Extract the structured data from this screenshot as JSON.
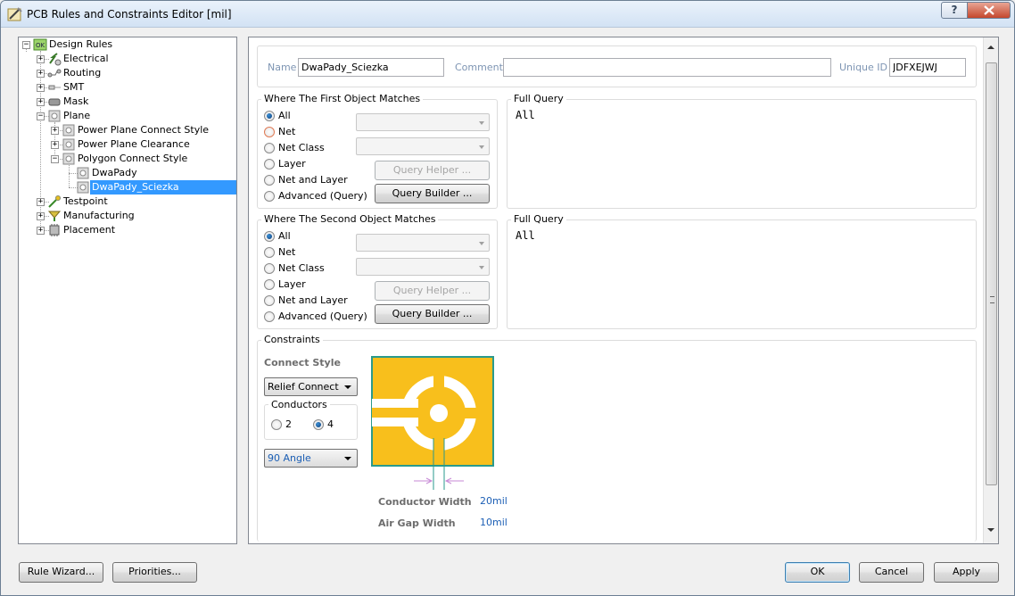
{
  "window": {
    "title": "PCB Rules and Constraints Editor [mil]",
    "help_glyph": "?",
    "close_glyph": "X"
  },
  "tree": {
    "items": [
      {
        "label": "Design Rules",
        "icon": "design-rules-icon"
      },
      {
        "label": "Electrical",
        "icon": "electrical-icon"
      },
      {
        "label": "Routing",
        "icon": "routing-icon"
      },
      {
        "label": "SMT",
        "icon": "smt-icon"
      },
      {
        "label": "Mask",
        "icon": "mask-icon"
      },
      {
        "label": "Plane",
        "icon": "plane-icon"
      },
      {
        "label": "Power Plane Connect Style",
        "icon": "rule-icon"
      },
      {
        "label": "Power Plane Clearance",
        "icon": "rule-icon"
      },
      {
        "label": "Polygon Connect Style",
        "icon": "rule-icon"
      },
      {
        "label": "DwaPady",
        "icon": "rule-icon"
      },
      {
        "label": "DwaPady_Sciezka",
        "icon": "rule-icon"
      },
      {
        "label": "Testpoint",
        "icon": "testpoint-icon"
      },
      {
        "label": "Manufacturing",
        "icon": "manufacturing-icon"
      },
      {
        "label": "Placement",
        "icon": "placement-icon"
      }
    ],
    "plus": "+",
    "minus": "−"
  },
  "rule": {
    "name_label": "Name",
    "name_value": "DwaPady_Sciezka",
    "comment_label": "Comment",
    "comment_value": "",
    "unique_id_label": "Unique ID",
    "unique_id_value": "JDFXEJWJ"
  },
  "first_object": {
    "title": "Where The First Object Matches",
    "options": [
      "All",
      "Net",
      "Net Class",
      "Layer",
      "Net and Layer",
      "Advanced (Query)"
    ],
    "selected": "All",
    "query_helper": "Query Helper ...",
    "query_builder": "Query Builder ...",
    "full_query_title": "Full Query",
    "full_query": "All"
  },
  "second_object": {
    "title": "Where The Second Object Matches",
    "options": [
      "All",
      "Net",
      "Net Class",
      "Layer",
      "Net and Layer",
      "Advanced (Query)"
    ],
    "selected": "All",
    "query_helper": "Query Helper ...",
    "query_builder": "Query Builder ...",
    "full_query_title": "Full Query",
    "full_query": "All"
  },
  "constraints": {
    "title": "Constraints",
    "connect_style_label": "Connect Style",
    "connect_style_value": "Relief Connect",
    "conductors_label": "Conductors",
    "conductors_options": [
      "2",
      "4"
    ],
    "conductors_selected": "4",
    "angle_value": "90 Angle",
    "conductor_width_label": "Conductor Width",
    "conductor_width_value": "20mil",
    "air_gap_label": "Air Gap Width",
    "air_gap_value": "10mil",
    "colors": {
      "pad": "#f8bf1c",
      "outline": "#2a9a8c",
      "value_text": "#1c5fb5",
      "arrow": "#c78ad6"
    }
  },
  "footer": {
    "rule_wizard": "Rule Wizard...",
    "priorities": "Priorities...",
    "ok": "OK",
    "cancel": "Cancel",
    "apply": "Apply"
  }
}
